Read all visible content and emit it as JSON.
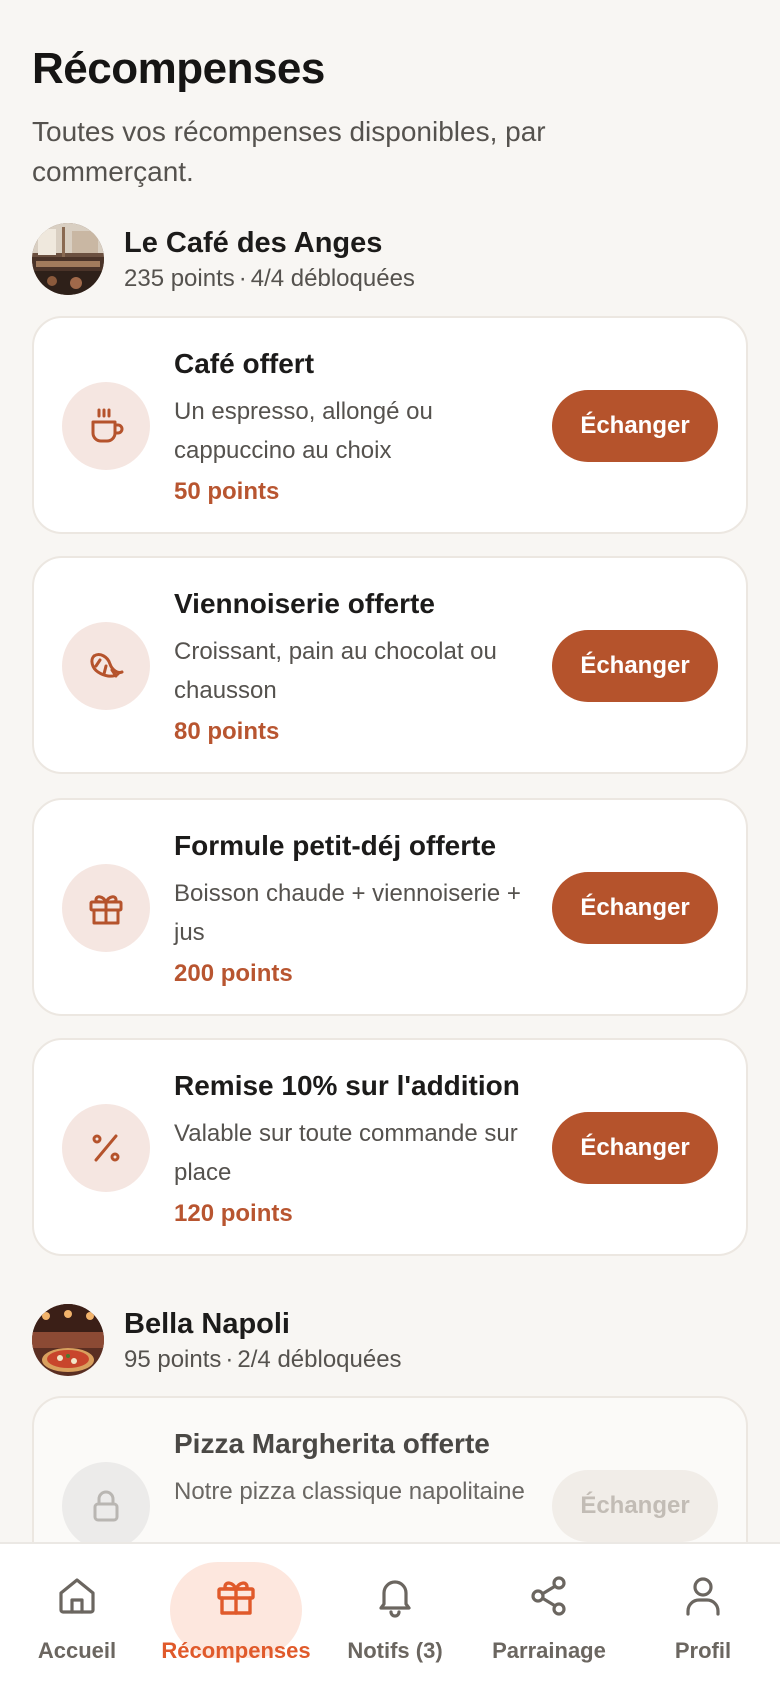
{
  "header": {
    "title": "Récompenses",
    "subtitle": "Toutes vos récompenses disponibles, par commerçant."
  },
  "merchants": [
    {
      "name": "Le Café des Anges",
      "points": "235 points",
      "unlocked": "4/4 débloquées",
      "rewards": [
        {
          "icon": "coffee-cup-icon",
          "name": "Café offert",
          "description": "Un espresso, allongé ou cappuccino au choix",
          "points": "50 points",
          "action": "Échanger",
          "locked": false
        },
        {
          "icon": "croissant-icon",
          "name": "Viennoiserie offerte",
          "description": "Croissant, pain au chocolat ou chausson",
          "points": "80 points",
          "action": "Échanger",
          "locked": false
        },
        {
          "icon": "gift-icon",
          "name": "Formule petit-déj offerte",
          "description": "Boisson chaude + viennoiserie + jus",
          "points": "200 points",
          "action": "Échanger",
          "locked": false
        },
        {
          "icon": "percent-icon",
          "name": "Remise 10% sur l'addition",
          "description": "Valable sur toute commande sur place",
          "points": "120 points",
          "action": "Échanger",
          "locked": false
        }
      ]
    },
    {
      "name": "Bella Napoli",
      "points": "95 points",
      "unlocked": "2/4 débloquées",
      "rewards": [
        {
          "icon": "lock-icon",
          "name": "Pizza Margherita offerte",
          "description": "Notre pizza classique napolitaine",
          "points": "",
          "action": "Échanger",
          "locked": true
        }
      ]
    }
  ],
  "meta_separator": "·",
  "tabbar": {
    "items": [
      {
        "label": "Accueil",
        "icon": "home-icon",
        "active": false
      },
      {
        "label": "Récompenses",
        "icon": "gift-icon",
        "active": true
      },
      {
        "label": "Notifs (3)",
        "icon": "bell-icon",
        "active": false
      },
      {
        "label": "Parrainage",
        "icon": "share-icon",
        "active": false
      },
      {
        "label": "Profil",
        "icon": "user-icon",
        "active": false
      }
    ]
  },
  "colors": {
    "accent": "#b5532c",
    "accent_text": "#b85530",
    "tab_active": "#e05a2b",
    "tab_active_bg": "#fde7de",
    "icon_bg": "#f5e6e1",
    "background": "#f8f6f3"
  }
}
